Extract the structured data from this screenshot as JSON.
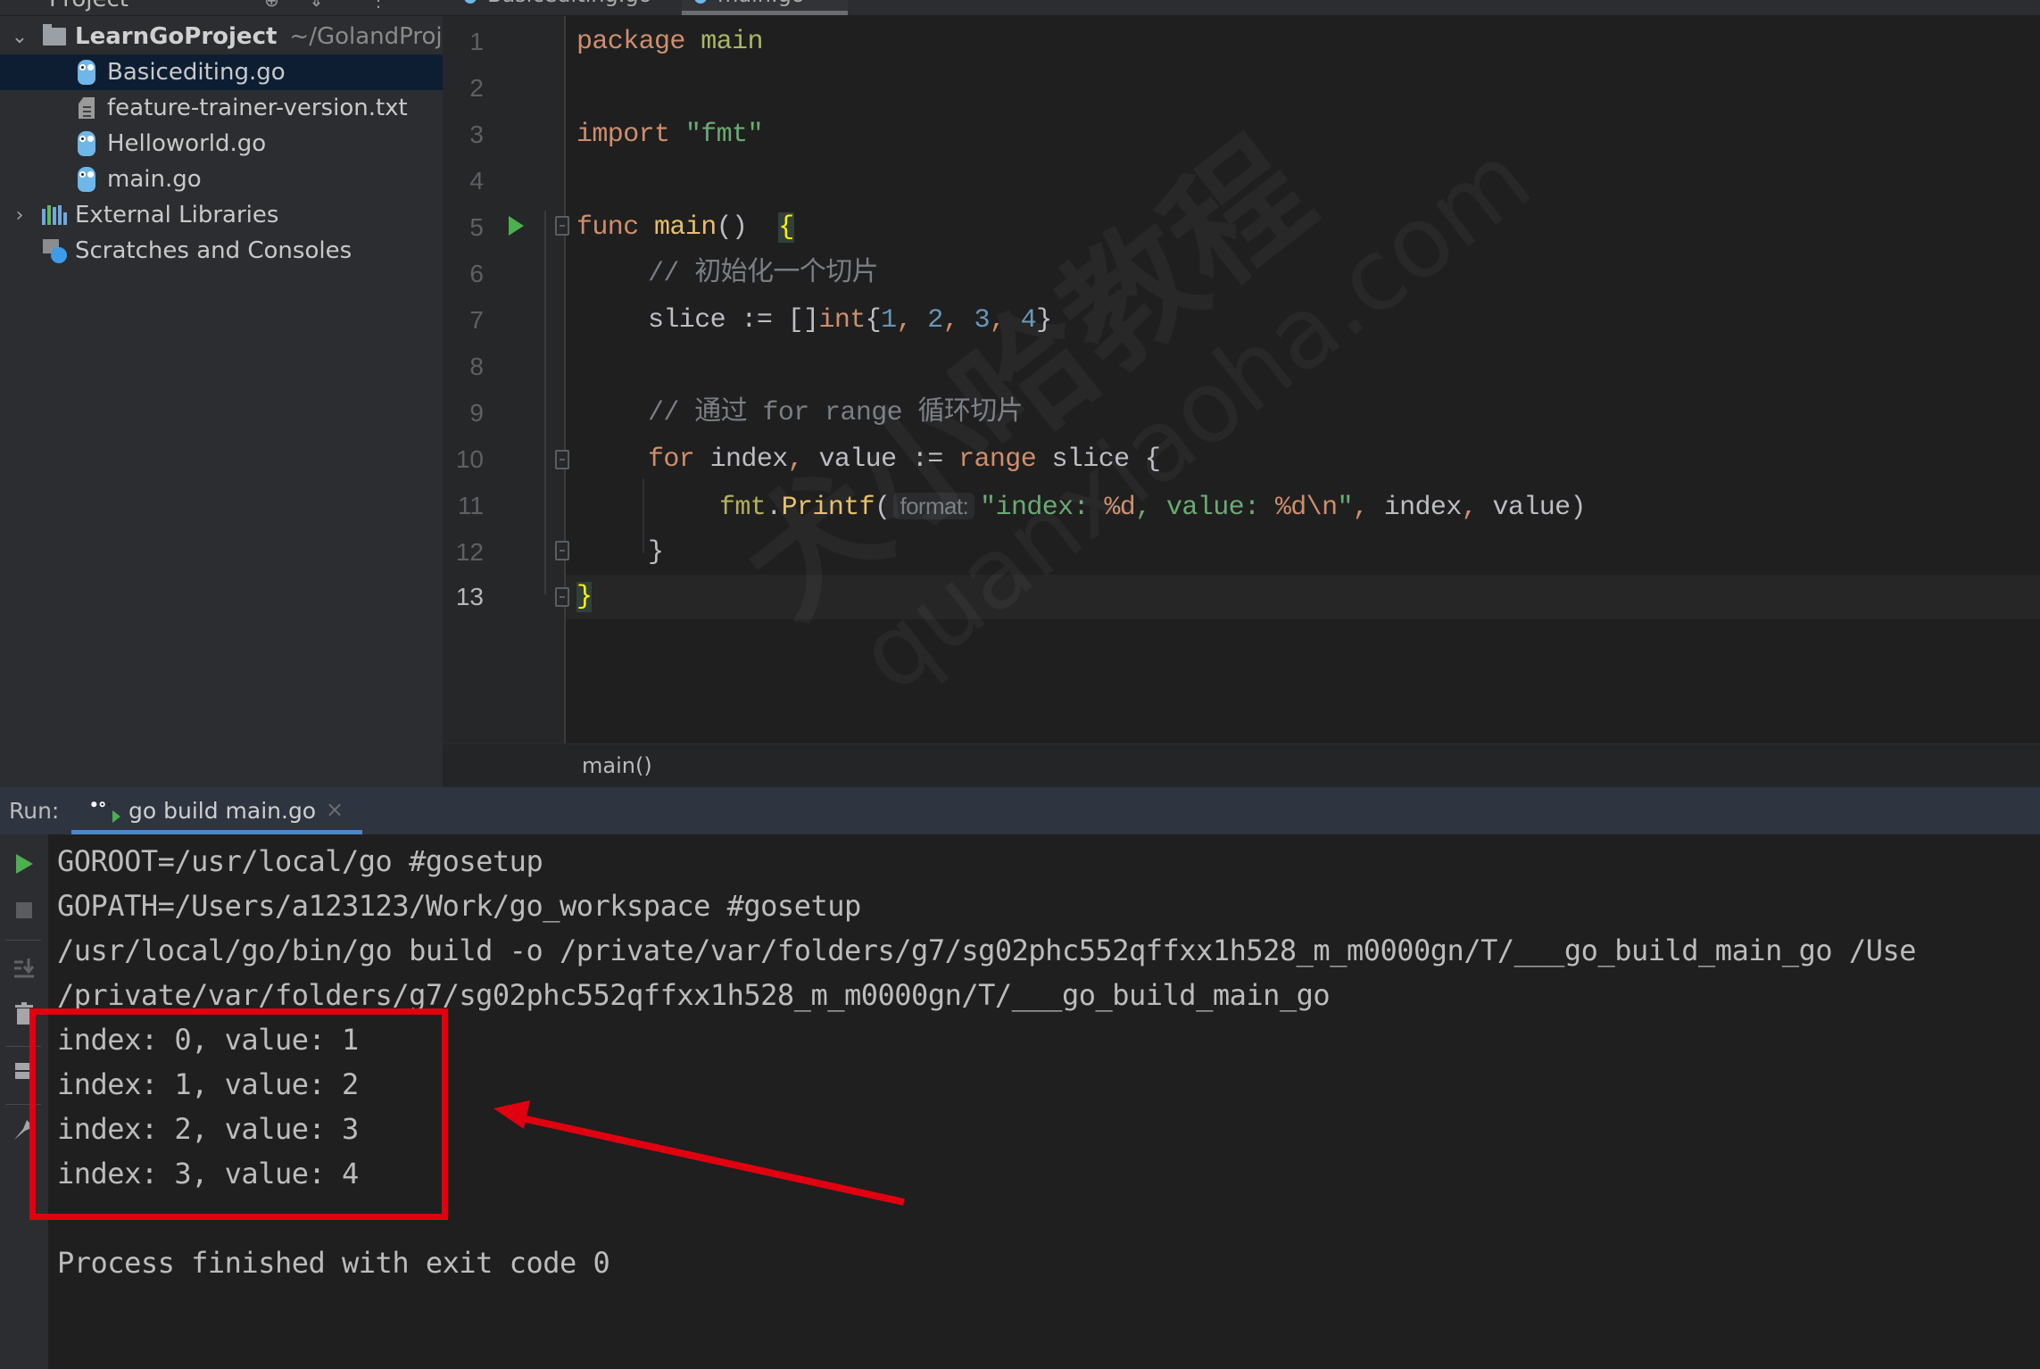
{
  "project_panel": {
    "header_label": "Project",
    "tree": [
      {
        "label": "LearnGoProject",
        "path": "~/GolandProjects",
        "type": "folder",
        "expanded": true
      },
      {
        "label": "Basicediting.go",
        "type": "go-file",
        "selected": true
      },
      {
        "label": "feature-trainer-version.txt",
        "type": "text-file"
      },
      {
        "label": "Helloworld.go",
        "type": "go-file"
      },
      {
        "label": "main.go",
        "type": "go-file"
      },
      {
        "label": "External Libraries",
        "type": "libraries",
        "expanded": false
      },
      {
        "label": "Scratches and Consoles",
        "type": "scratches"
      }
    ]
  },
  "editor": {
    "tabs": [
      {
        "label": "Basicediting.go",
        "active": false
      },
      {
        "label": "main.go",
        "active": true
      }
    ],
    "current_line": 13,
    "lines": [
      {
        "n": "1"
      },
      {
        "n": "2"
      },
      {
        "n": "3"
      },
      {
        "n": "4"
      },
      {
        "n": "5"
      },
      {
        "n": "6"
      },
      {
        "n": "7"
      },
      {
        "n": "8"
      },
      {
        "n": "9"
      },
      {
        "n": "10"
      },
      {
        "n": "11"
      },
      {
        "n": "12"
      },
      {
        "n": "13"
      }
    ],
    "code": {
      "l1_kw": "package",
      "l1_name": "main",
      "l3_kw": "import",
      "l3_str": "\"fmt\"",
      "l5_kw": "func",
      "l5_name": "main",
      "l5_parens": "()",
      "l5_brace": "{",
      "l6_comment": "// 初始化一个切片",
      "l7_var": "slice := []",
      "l7_type": "int",
      "l7_open": "{",
      "l7_values": [
        "1",
        "2",
        "3",
        "4"
      ],
      "l7_close": "}",
      "l9_comment": "// 通过 for range 循环切片",
      "l10_for": "for",
      "l10_vars": "index",
      "l10_comma": ",",
      "l10_value": "value :=",
      "l10_range": "range",
      "l10_rest": "slice {",
      "l11_pkg": "fmt",
      "l11_dot": ".",
      "l11_fn": "Printf",
      "l11_open": "(",
      "l11_hint": "format:",
      "l11_str1": "\"index: ",
      "l11_fmt1": "%d",
      "l11_str2": ", value: ",
      "l11_fmt2": "%d\\n",
      "l11_str3": "\"",
      "l11_args": "index",
      "l11_args2": "value)",
      "l12_brace": "}",
      "l13_brace": "}"
    },
    "breadcrumb": "main()"
  },
  "watermark": {
    "text_cn": "犬小哈教程",
    "text_en": "quanxiaoha.com"
  },
  "run_panel": {
    "label": "Run:",
    "tab_label": "go build main.go",
    "close_glyph": "×",
    "console_lines": [
      "GOROOT=/usr/local/go #gosetup",
      "GOPATH=/Users/a123123/Work/go_workspace #gosetup",
      "/usr/local/go/bin/go build -o /private/var/folders/g7/sg02phc552qffxx1h528_m_m0000gn/T/___go_build_main_go /Use",
      "/private/var/folders/g7/sg02phc552qffxx1h528_m_m0000gn/T/___go_build_main_go",
      "index: 0, value: 1",
      "index: 1, value: 2",
      "index: 2, value: 3",
      "index: 3, value: 4",
      "",
      "Process finished with exit code 0"
    ],
    "toolbar_icons": [
      "rerun-icon",
      "stop-icon",
      "scroll-to-end-icon",
      "clear-icon",
      "layout-icon",
      "pin-icon"
    ]
  },
  "colors": {
    "annotation_red": "#e0000f",
    "run_green": "#4caf50",
    "tab_accent": "#4a88c7",
    "keyword": "#cf8e6d",
    "string": "#6aab73",
    "number": "#6897bb"
  }
}
